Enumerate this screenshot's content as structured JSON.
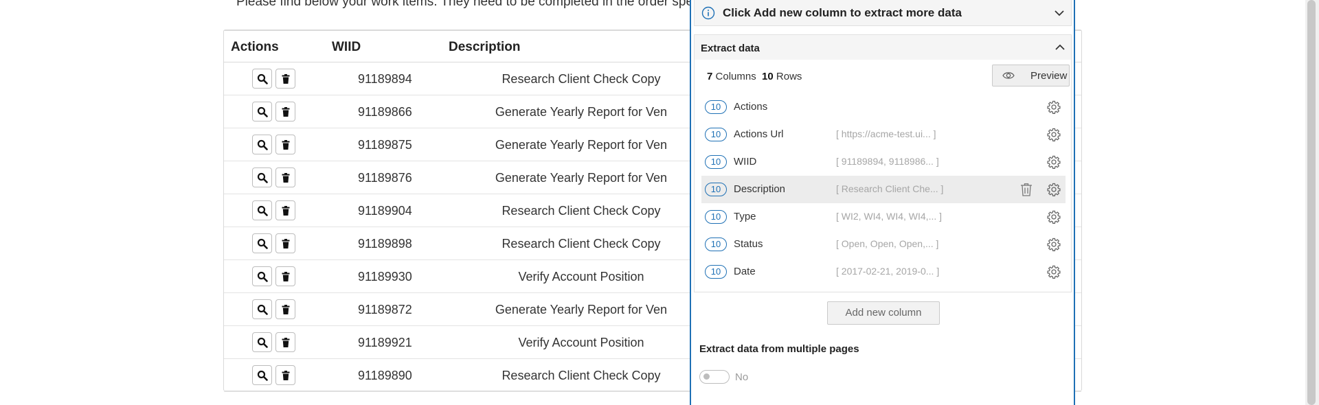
{
  "page": {
    "intro_text": "Please find below your work items. They need to be completed in the order specified",
    "table": {
      "headers": [
        "Actions",
        "WIID",
        "Description"
      ],
      "rows": [
        {
          "wiid": "91189894",
          "description": "Research Client Check Copy"
        },
        {
          "wiid": "91189866",
          "description": "Generate Yearly Report for Ven"
        },
        {
          "wiid": "91189875",
          "description": "Generate Yearly Report for Ven"
        },
        {
          "wiid": "91189876",
          "description": "Generate Yearly Report for Ven"
        },
        {
          "wiid": "91189904",
          "description": "Research Client Check Copy"
        },
        {
          "wiid": "91189898",
          "description": "Research Client Check Copy"
        },
        {
          "wiid": "91189930",
          "description": "Verify Account Position"
        },
        {
          "wiid": "91189872",
          "description": "Generate Yearly Report for Ven"
        },
        {
          "wiid": "91189921",
          "description": "Verify Account Position"
        },
        {
          "wiid": "91189890",
          "description": "Research Client Check Copy"
        }
      ]
    }
  },
  "panel": {
    "info_text": "Click Add new column to extract more data",
    "extract_title": "Extract data",
    "summary": {
      "columns_count": "7",
      "columns_label": "Columns",
      "rows_count": "10",
      "rows_label": "Rows"
    },
    "preview_label": "Preview",
    "columns": [
      {
        "count": "10",
        "name": "Actions",
        "sample": ""
      },
      {
        "count": "10",
        "name": "Actions Url",
        "sample": "[ https://acme-test.ui... ]"
      },
      {
        "count": "10",
        "name": "WIID",
        "sample": "[ 91189894, 9118986... ]"
      },
      {
        "count": "10",
        "name": "Description",
        "sample": "[ Research Client Che... ]"
      },
      {
        "count": "10",
        "name": "Type",
        "sample": "[ WI2, WI4, WI4, WI4,... ]"
      },
      {
        "count": "10",
        "name": "Status",
        "sample": "[ Open, Open, Open,... ]"
      },
      {
        "count": "10",
        "name": "Date",
        "sample": "[ 2017-02-21, 2019-0... ]"
      }
    ],
    "add_column_label": "Add new column",
    "multi_pages_title": "Extract data from multiple pages",
    "toggle_label": "No"
  },
  "colors": {
    "accent": "#1e70b5",
    "muted_text": "#a6a6a6"
  }
}
